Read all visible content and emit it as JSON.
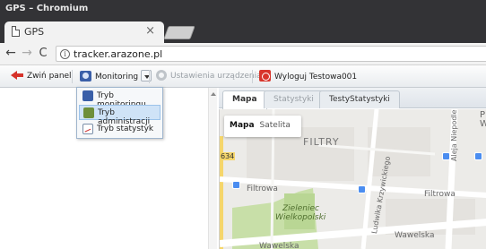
{
  "window": {
    "title": "GPS – Chromium"
  },
  "tab": {
    "title": "GPS",
    "close": "×"
  },
  "browser": {
    "back": "←",
    "forward": "→",
    "reload": "C",
    "info": "i",
    "url": "tracker.arazone.pl"
  },
  "toolbar": {
    "collapse_label": "Zwiń panel",
    "monitoring_label": "Monitoring",
    "settings_label": "Ustawienia urządzenia",
    "settings_enabled": false,
    "logout_label": "Wyloguj Testowa001"
  },
  "menu": {
    "items": [
      {
        "label": "Tryb monitoringu",
        "selected": false,
        "icon": "monitor-icon"
      },
      {
        "label": "Tryb administracji",
        "selected": true,
        "icon": "admin-icon"
      },
      {
        "label": "Tryb statystyk",
        "selected": false,
        "icon": "stats-icon"
      }
    ]
  },
  "right_tabs": [
    {
      "label": "Mapa",
      "active": true
    },
    {
      "label": "Statystyki",
      "active": false
    },
    {
      "label": "TestyStatystyki",
      "active": false
    }
  ],
  "map": {
    "type_control": {
      "map": "Mapa",
      "satellite": "Satelita"
    },
    "labels": {
      "district": "FILTRY",
      "street_filtrowa_left": "Filtrowa",
      "street_filtrowa_right": "Filtrowa",
      "park_line1": "Zieleniec",
      "park_line2": "Wielkopolski",
      "street_krzywickiego": "Ludwika Krzywickiego",
      "street_niepodleglosci": "Aleja Niepodległości",
      "street_wawelska_right": "Wawelska",
      "street_wawelska_left": "Wawelska",
      "road_number": "634",
      "edge_label": "P",
      "edge_label2": "W"
    },
    "colors": {
      "land": "#ecebe8",
      "road": "#ffffff",
      "park": "#c8dfa8",
      "highway": "#f5d66b",
      "poi": "#4b8df0"
    }
  }
}
